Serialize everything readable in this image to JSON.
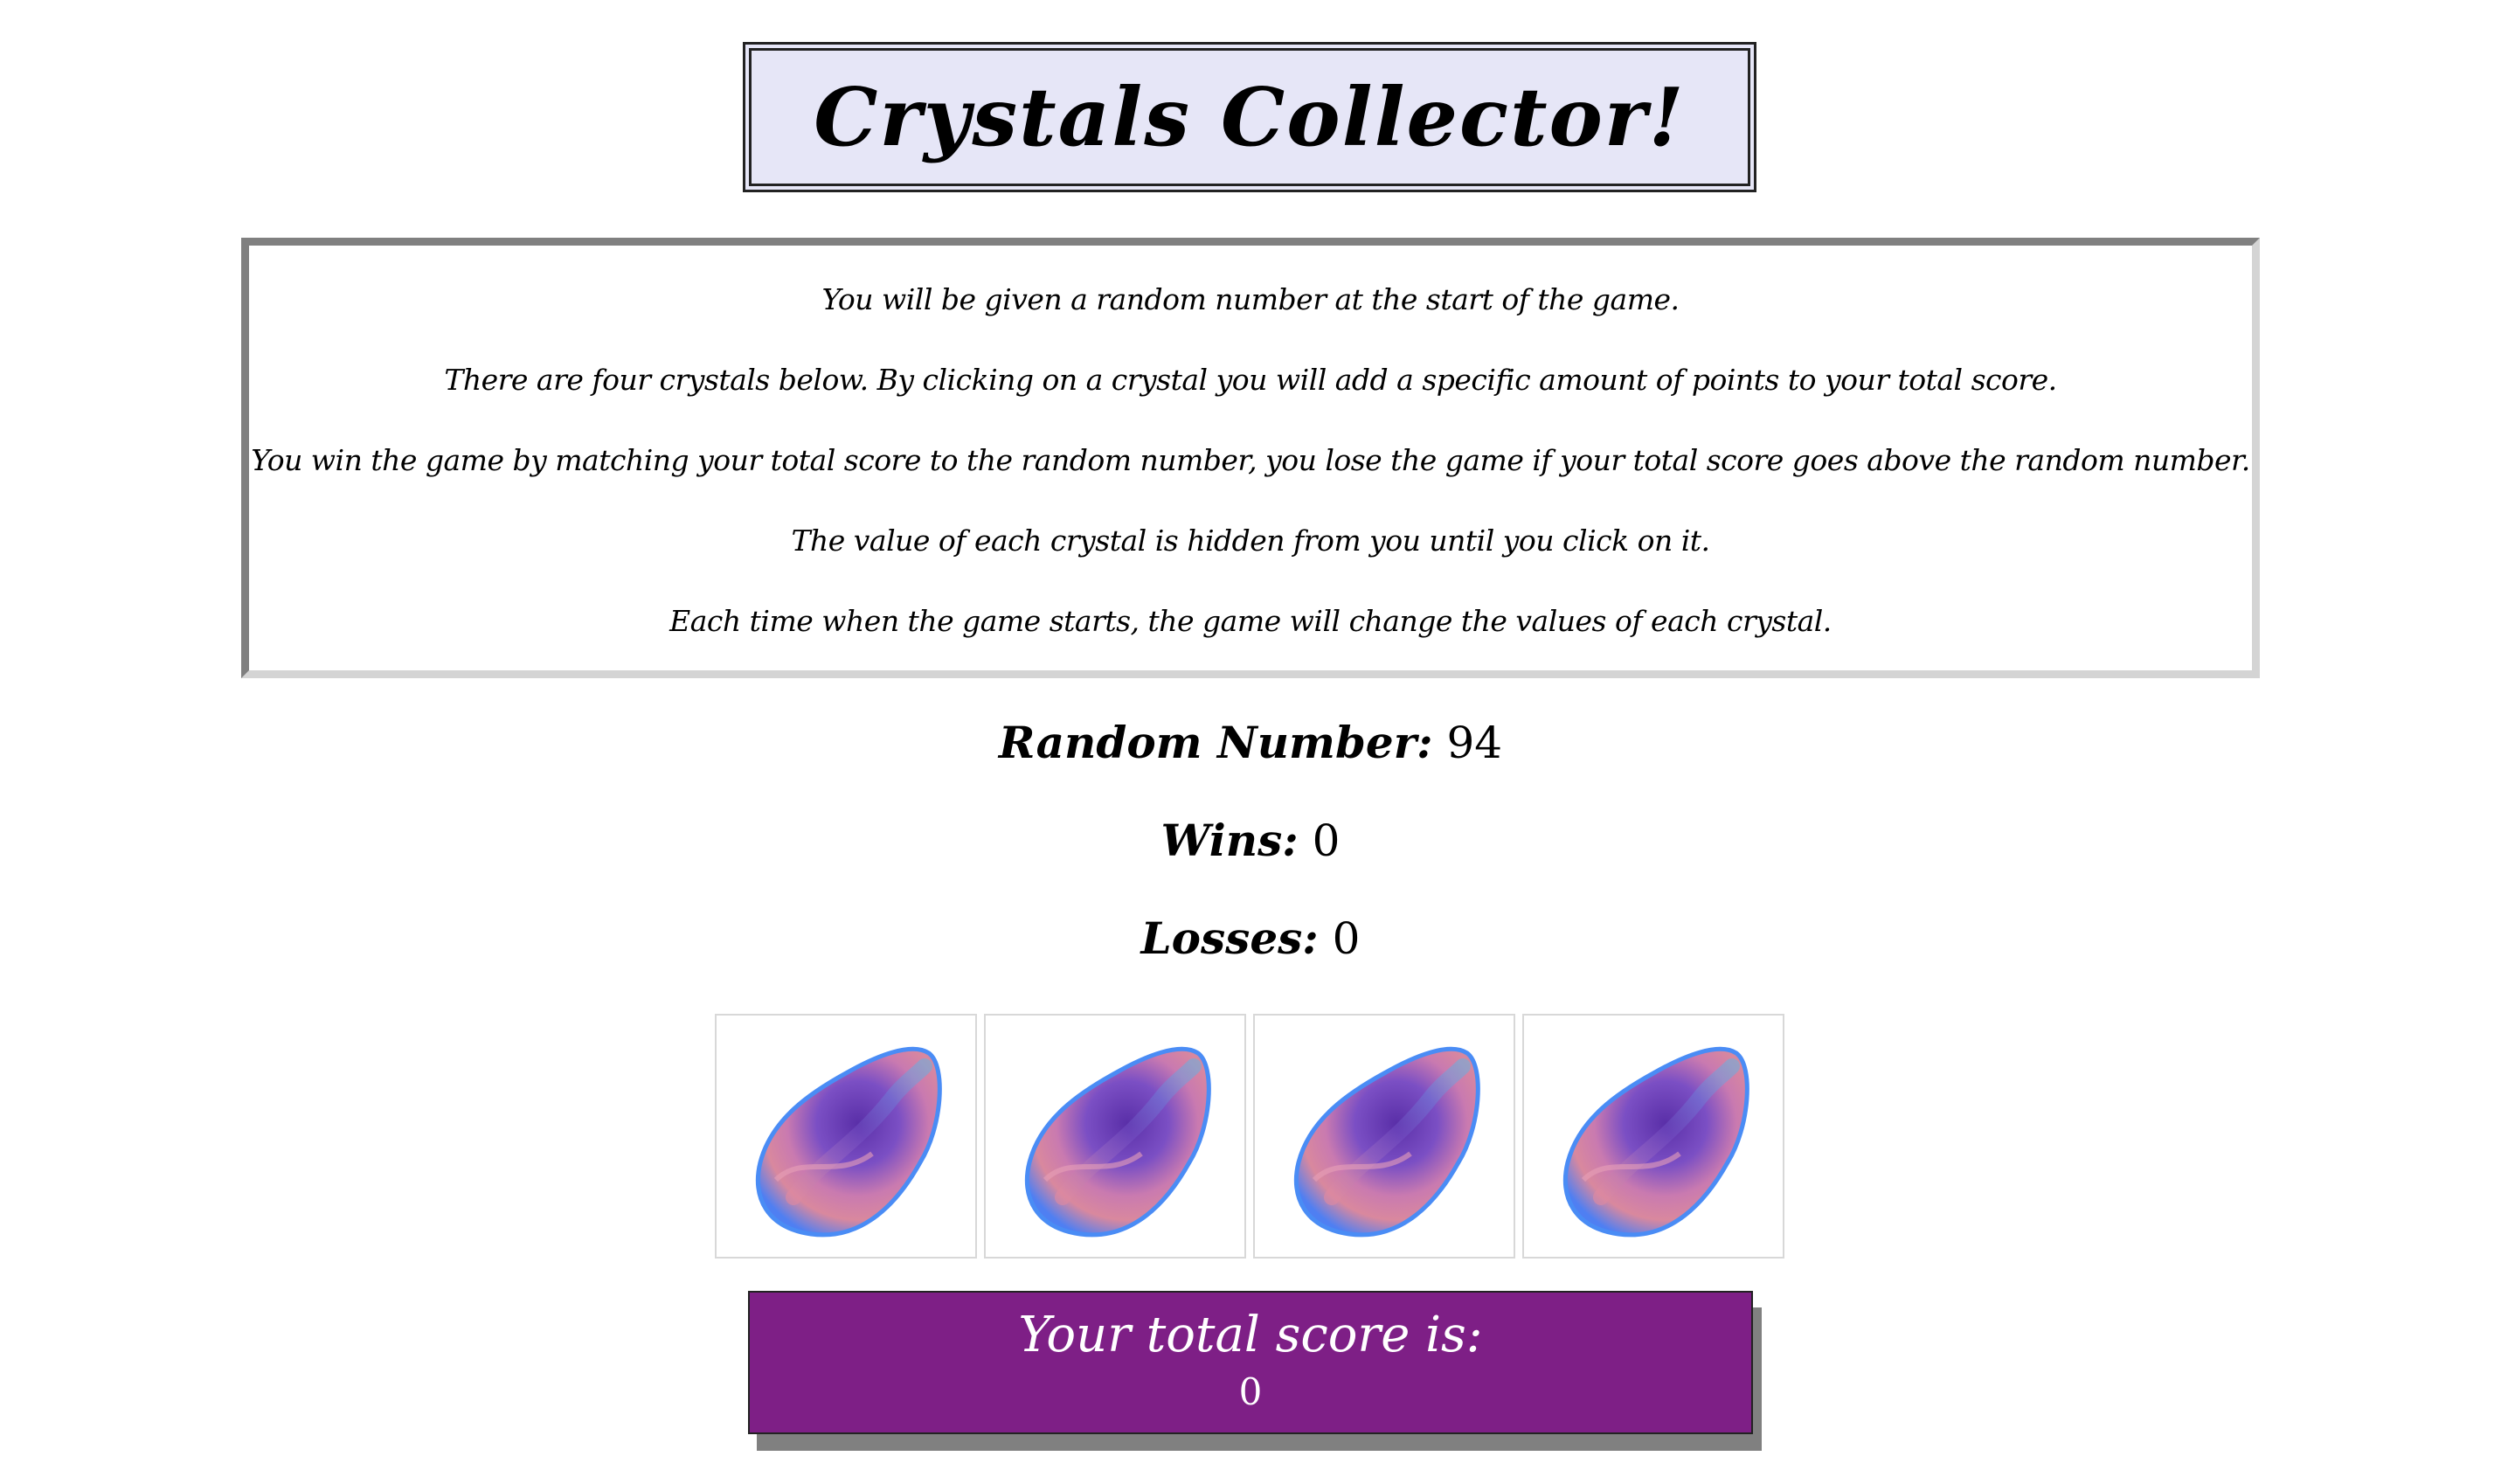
{
  "title": "Crystals Collector!",
  "instructions": [
    "You will be given a random number at the start of the game.",
    "There are four crystals below. By clicking on a crystal you will add a specific amount of points to your total score.",
    "You win the game by matching your total score to the random number, you lose the game if your total score goes above the random number.",
    "The value of each crystal is hidden from you until you click on it.",
    "Each time when the game starts, the game will change the values of each crystal."
  ],
  "stats": {
    "random_label": "Random Number:",
    "random_value": "94",
    "wins_label": "Wins:",
    "wins_value": "0",
    "losses_label": "Losses:",
    "losses_value": "0"
  },
  "crystals": [
    {
      "icon": "crystal-icon"
    },
    {
      "icon": "crystal-icon"
    },
    {
      "icon": "crystal-icon"
    },
    {
      "icon": "crystal-icon"
    }
  ],
  "score": {
    "label": "Your total score is:",
    "value": "0"
  },
  "colors": {
    "title_bg": "#e6e6f7",
    "score_bg": "#7e1f86",
    "crystal_blue": "#4a7cf0",
    "crystal_purple": "#6a3fb8",
    "crystal_pink": "#d87aa8"
  }
}
